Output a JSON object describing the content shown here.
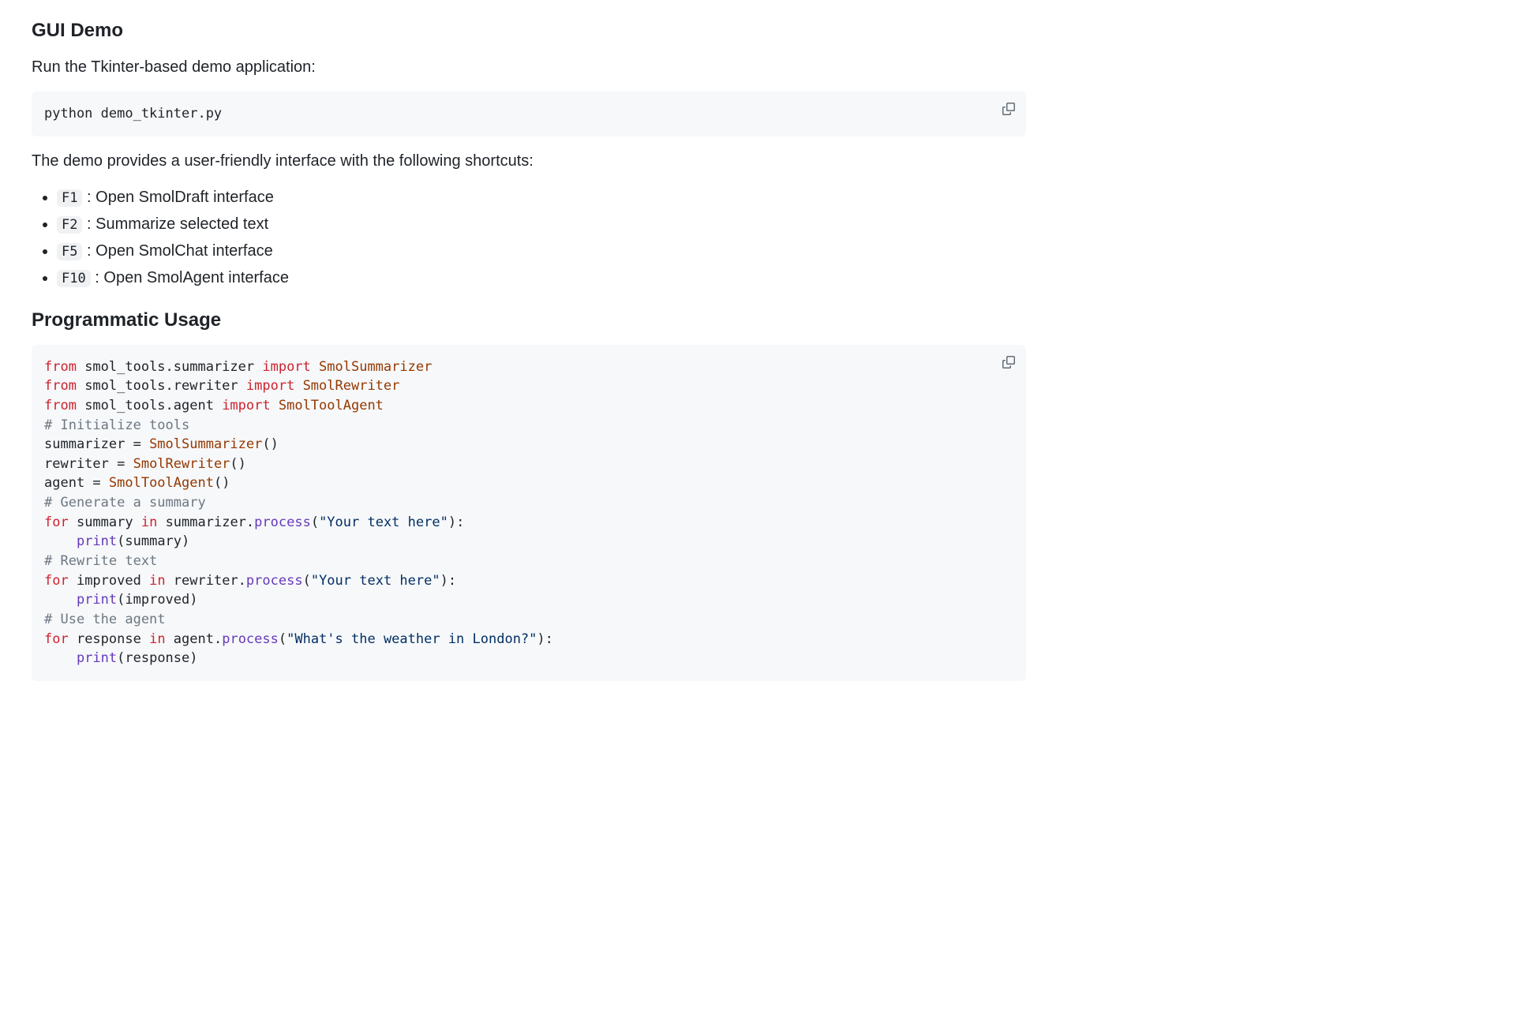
{
  "section1": {
    "heading": "GUI Demo",
    "intro": "Run the Tkinter-based demo application:",
    "command": "python demo_tkinter.py",
    "after": "The demo provides a user-friendly interface with the following shortcuts:",
    "shortcuts": [
      {
        "key": "F1",
        "desc": "Open SmolDraft interface"
      },
      {
        "key": "F2",
        "desc": "Summarize selected text"
      },
      {
        "key": "F5",
        "desc": "Open SmolChat interface"
      },
      {
        "key": "F10",
        "desc": "Open SmolAgent interface"
      }
    ]
  },
  "section2": {
    "heading": "Programmatic Usage",
    "code_tokens": [
      [
        {
          "c": "kw",
          "t": "from"
        },
        {
          "c": "plain",
          "t": " smol_tools.summarizer "
        },
        {
          "c": "kw",
          "t": "import"
        },
        {
          "c": "plain",
          "t": " "
        },
        {
          "c": "cls",
          "t": "SmolSummarizer"
        }
      ],
      [
        {
          "c": "kw",
          "t": "from"
        },
        {
          "c": "plain",
          "t": " smol_tools.rewriter "
        },
        {
          "c": "kw",
          "t": "import"
        },
        {
          "c": "plain",
          "t": " "
        },
        {
          "c": "cls",
          "t": "SmolRewriter"
        }
      ],
      [
        {
          "c": "kw",
          "t": "from"
        },
        {
          "c": "plain",
          "t": " smol_tools.agent "
        },
        {
          "c": "kw",
          "t": "import"
        },
        {
          "c": "plain",
          "t": " "
        },
        {
          "c": "cls",
          "t": "SmolToolAgent"
        }
      ],
      [
        {
          "c": "com",
          "t": "# Initialize tools"
        }
      ],
      [
        {
          "c": "plain",
          "t": "summarizer = "
        },
        {
          "c": "cls",
          "t": "SmolSummarizer"
        },
        {
          "c": "plain",
          "t": "()"
        }
      ],
      [
        {
          "c": "plain",
          "t": "rewriter = "
        },
        {
          "c": "cls",
          "t": "SmolRewriter"
        },
        {
          "c": "plain",
          "t": "()"
        }
      ],
      [
        {
          "c": "plain",
          "t": "agent = "
        },
        {
          "c": "cls",
          "t": "SmolToolAgent"
        },
        {
          "c": "plain",
          "t": "()"
        }
      ],
      [
        {
          "c": "com",
          "t": "# Generate a summary"
        }
      ],
      [
        {
          "c": "kw",
          "t": "for"
        },
        {
          "c": "plain",
          "t": " summary "
        },
        {
          "c": "kw",
          "t": "in"
        },
        {
          "c": "plain",
          "t": " summarizer."
        },
        {
          "c": "fn",
          "t": "process"
        },
        {
          "c": "plain",
          "t": "("
        },
        {
          "c": "str",
          "t": "\"Your text here\""
        },
        {
          "c": "plain",
          "t": "):"
        }
      ],
      [
        {
          "c": "plain",
          "t": "    "
        },
        {
          "c": "fn",
          "t": "print"
        },
        {
          "c": "plain",
          "t": "(summary)"
        }
      ],
      [
        {
          "c": "com",
          "t": "# Rewrite text"
        }
      ],
      [
        {
          "c": "kw",
          "t": "for"
        },
        {
          "c": "plain",
          "t": " improved "
        },
        {
          "c": "kw",
          "t": "in"
        },
        {
          "c": "plain",
          "t": " rewriter."
        },
        {
          "c": "fn",
          "t": "process"
        },
        {
          "c": "plain",
          "t": "("
        },
        {
          "c": "str",
          "t": "\"Your text here\""
        },
        {
          "c": "plain",
          "t": "):"
        }
      ],
      [
        {
          "c": "plain",
          "t": "    "
        },
        {
          "c": "fn",
          "t": "print"
        },
        {
          "c": "plain",
          "t": "(improved)"
        }
      ],
      [
        {
          "c": "com",
          "t": "# Use the agent"
        }
      ],
      [
        {
          "c": "kw",
          "t": "for"
        },
        {
          "c": "plain",
          "t": " response "
        },
        {
          "c": "kw",
          "t": "in"
        },
        {
          "c": "plain",
          "t": " agent."
        },
        {
          "c": "fn",
          "t": "process"
        },
        {
          "c": "plain",
          "t": "("
        },
        {
          "c": "str",
          "t": "\"What's the weather in London?\""
        },
        {
          "c": "plain",
          "t": "):"
        }
      ],
      [
        {
          "c": "plain",
          "t": "    "
        },
        {
          "c": "fn",
          "t": "print"
        },
        {
          "c": "plain",
          "t": "(response)"
        }
      ]
    ]
  }
}
